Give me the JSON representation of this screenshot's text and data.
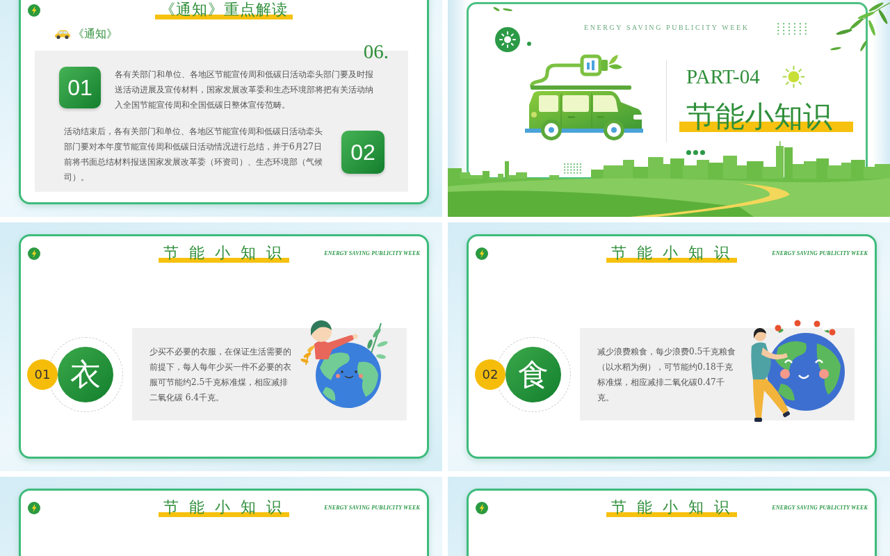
{
  "slides": [
    {
      "kind": "notice",
      "title": "《通知》重点解读",
      "heading": "《通知》",
      "number": "06.",
      "items": [
        {
          "number": "01",
          "text": "各有关部门和单位、各地区节能宣传周和低碳日活动牵头部门要及时报送活动进展及宣传材料，国家发展改革委和生态环境部将把有关活动纳入全国节能宣传周和全国低碳日整体宣传范畴。"
        },
        {
          "number": "02",
          "text": "活动结束后，各有关部门和单位、各地区节能宣传周和低碳日活动牵头部门要对本年度节能宣传周和低碳日活动情况进行总结，并于6月27日前将书面总结材料报送国家发展改革委（环资司）、生态环境部（气候司）。"
        }
      ]
    },
    {
      "kind": "cover",
      "tagline": "ENERGY SAVING PUBLICITY WEEK",
      "part": "PART-04",
      "title": "节能小知识"
    },
    {
      "kind": "tip",
      "title": "节 能 小 知 识",
      "tagline": "ENERGY SAVING PUBLICITY WEEK",
      "number": "01",
      "character": "衣",
      "text": "少买不必要的衣服，在保证生活需要的前提下，每人每年少买一件不必要的衣服可节能约2.5千克标准煤，相应减排二氧化碳 6.4千克。"
    },
    {
      "kind": "tip",
      "title": "节 能 小 知 识",
      "tagline": "ENERGY SAVING PUBLICITY WEEK",
      "number": "02",
      "character": "食",
      "text": "减少浪费粮食，每少浪费0.5千克粮食（以水稻为例），可节能约0.18千克标准煤，相应减排二氧化碳0.47千克。"
    },
    {
      "kind": "header",
      "title": "节 能 小 知 识",
      "tagline": "ENERGY SAVING PUBLICITY WEEK"
    },
    {
      "kind": "header",
      "title": "节 能 小 知 识",
      "tagline": "ENERGY SAVING PUBLICITY WEEK"
    }
  ]
}
